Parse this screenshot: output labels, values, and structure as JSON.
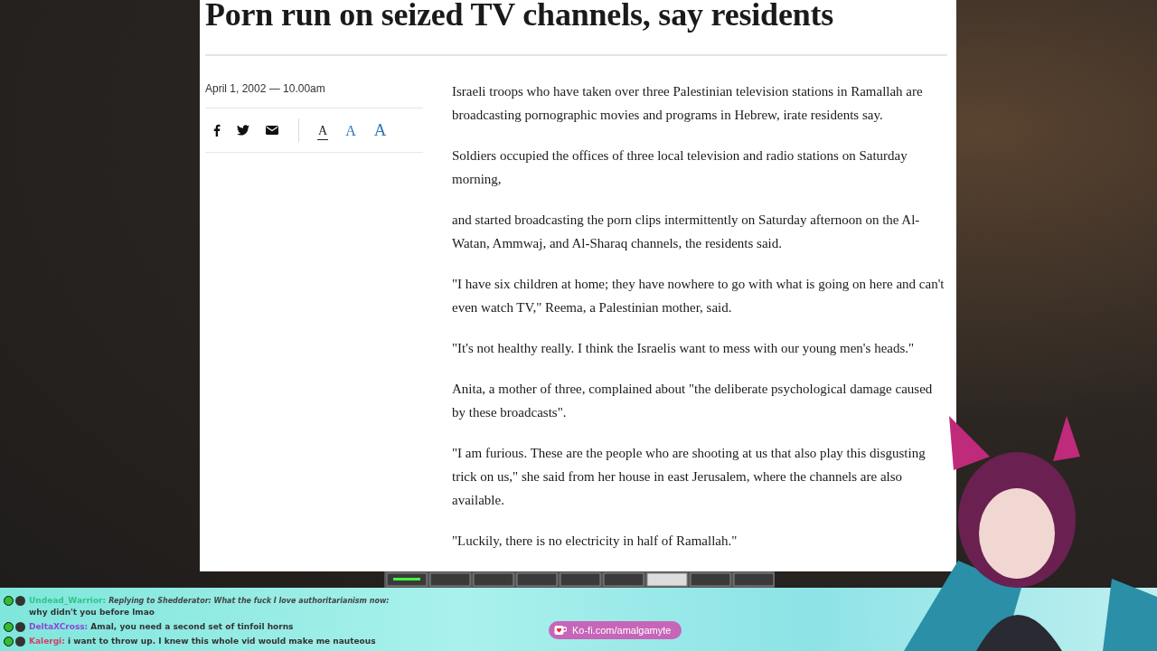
{
  "article": {
    "title": "Porn run on seized TV channels, say residents",
    "dateline": "April 1, 2002 — 10.00am",
    "share": [
      {
        "kind": "facebook"
      },
      {
        "kind": "twitter"
      },
      {
        "kind": "email"
      }
    ],
    "font_sizes": [
      {
        "label": "A",
        "selected": true
      },
      {
        "label": "A",
        "selected": false
      },
      {
        "label": "A",
        "selected": false
      }
    ],
    "paragraphs": [
      "Israeli troops who have taken over three Palestinian television stations in Ramallah are broadcasting pornographic movies and programs in Hebrew, irate residents say.",
      "Soldiers occupied the offices of three local television and radio stations on Saturday morning,",
      "and started broadcasting the porn clips intermittently on Saturday afternoon on the Al-Watan, Ammwaj, and Al-Sharaq channels, the residents said.",
      "\"I have six children at home; they have nowhere to go with what is going on here and can't even watch TV,\" Reema, a Palestinian mother, said.",
      "\"It's not healthy really. I think the Israelis want to mess with our young men's heads.\"",
      "Anita, a mother of three, complained about \"the deliberate psychological damage caused by these broadcasts\".",
      "\"I am furious. These are the people who are shooting at us that also play this disgusting trick on us,\" she said from her house in east Jerusalem, where the channels are also available.",
      "\"Luckily, there is no electricity in half of Ramallah.\""
    ]
  },
  "chat": {
    "messages": [
      {
        "user": "Undead_Warrior:",
        "color": "#2fc48a",
        "reply": "Replying to Shedderator: What the fuck I love authoritarianism now:",
        "text": "why didn't you before lmao"
      },
      {
        "user": "DeltaXCross:",
        "color": "#8e44d8",
        "text": "Amal, you need a second set of tinfoil horns"
      },
      {
        "user": "Kalergi:",
        "color": "#d0406a",
        "text": "i want to throw up. I knew this whole vid would make me nauteous"
      }
    ]
  },
  "kofi": {
    "label": "Ko-fi.com/amalgamyte"
  }
}
